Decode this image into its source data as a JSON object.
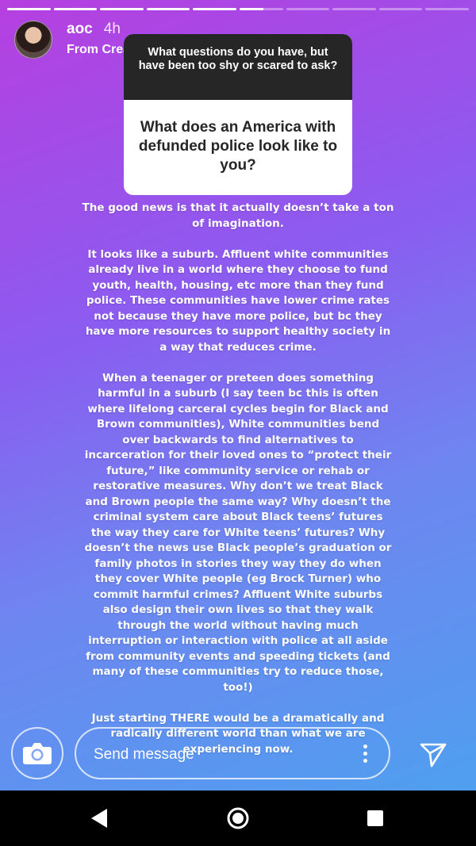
{
  "story": {
    "segment_count": 10,
    "active_segment_index": 5,
    "active_segment_progress": 0.55
  },
  "header": {
    "username": "aoc",
    "time": "4h",
    "subtitle": "From Create Mode"
  },
  "question_sticker": {
    "prompt": "What questions do you have, but have been too shy or scared to ask?",
    "question": "What does an America with defunded police look like to you?"
  },
  "answer_paragraphs": [
    "The good news is that it actually doesn’t take a ton\nof imagination.",
    "It looks like a suburb. Affluent white communities\nalready live in a world where they choose to fund\nyouth, health, housing, etc more than they fund\npolice. These communities have lower crime rates\nnot because they have more police, but bc they\nhave more resources to support healthy society in\na way that reduces crime.",
    "When a teenager or preteen does something\nharmful in a suburb (I say teen bc this is often\nwhere lifelong carceral cycles begin for Black and\nBrown communities), White communities bend\nover backwards to find alternatives to\nincarceration for their loved ones to “protect their\nfuture,” like community service or rehab or\nrestorative measures. Why don’t we treat Black\nand Brown people the same way? Why doesn’t the\ncriminal system care about Black teens’ futures\nthe way they care for White teens’ futures? Why\ndoesn’t the news use Black people’s graduation or\nfamily photos in stories they way they do when\nthey cover White people (eg Brock Turner) who\ncommit harmful crimes? Affluent White suburbs\nalso design their own lives so that they walk\nthrough the world without having much\ninterruption or interaction with police at all aside\nfrom community events and speeding tickets (and\nmany of these communities try to reduce those,\ntoo!)",
    "Just starting THERE would be a dramatically and\nradically different world than what we are\nexperiencing now."
  ],
  "bottom_bar": {
    "message_placeholder": "Send message",
    "camera_icon": "camera-icon",
    "more_icon": "more-vertical-icon",
    "send_icon": "send-icon"
  },
  "nav": {
    "back_icon": "back-triangle-icon",
    "home_icon": "home-circle-icon",
    "recents_icon": "recents-square-icon"
  },
  "colors": {
    "gradient_top": "#b63fe0",
    "gradient_mid": "#8b5cf0",
    "gradient_bottom": "#4f9ff0",
    "sticker_header": "#262626"
  }
}
